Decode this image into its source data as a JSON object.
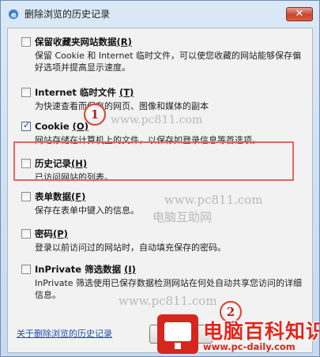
{
  "window": {
    "title": "删除浏览的历史记录",
    "close_label": "✕"
  },
  "options": [
    {
      "label": "保留收藏夹网站数据",
      "accel": "(R)",
      "checked": false,
      "desc": "保留 Cookie 和 Internet 临时文件，可以使您收藏的网站能够保存偏好选项并提高显示速度。"
    },
    {
      "label": "Internet 临时文件",
      "accel": "(T)",
      "checked": false,
      "desc": "为快速查看而保存的网页、图像和媒体的副本"
    },
    {
      "label": "Cookie",
      "accel": "(O)",
      "checked": true,
      "desc": "网站存储在计算机上的文件，以保存如登录信息等首选项。"
    },
    {
      "label": "历史记录",
      "accel": "(H)",
      "checked": false,
      "desc": "已访问网站的列表。"
    },
    {
      "label": "表单数据",
      "accel": "(F)",
      "checked": false,
      "desc": "保存在表单中键入的信息。"
    },
    {
      "label": "密码",
      "accel": "(P)",
      "checked": false,
      "desc": "登录以前访问过的网站时，自动填充保存的密码。"
    },
    {
      "label": "InPrivate 筛选数据",
      "accel": "(I)",
      "checked": false,
      "desc": "InPrivate 筛选使用已保存数据检测网站在何处自动共享您访问的详细信息。"
    }
  ],
  "callouts": [
    "1",
    "2"
  ],
  "footer": {
    "link": "关于删除浏览的历史记录"
  },
  "watermarks": {
    "url1": "www.pc811.com",
    "url2": "www.pc811.com",
    "url3": "www.pc811.com",
    "text1": "电脑互助网"
  },
  "brand": {
    "name": "电脑百科知识",
    "url": "www.pc-daily.com"
  }
}
